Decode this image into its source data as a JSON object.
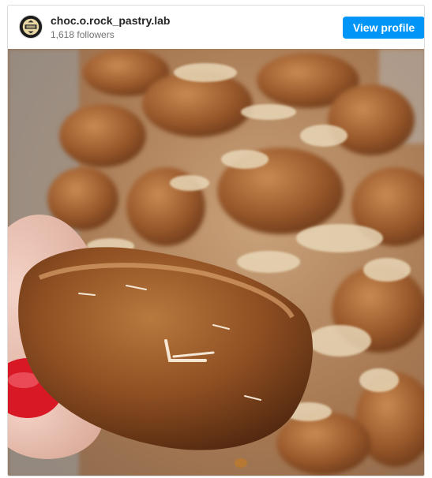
{
  "post": {
    "account_name": "choc.o.rock_pastry.lab",
    "followers": "1,618 followers",
    "view_profile_label": "View profile",
    "avatar_icon": "pastry-lab-logo-icon",
    "photo_description_icon": "pastry-photo"
  },
  "colors": {
    "button": "#0095f6",
    "text_primary": "#262626",
    "text_secondary": "#737373",
    "border": "#dbdbdb"
  }
}
